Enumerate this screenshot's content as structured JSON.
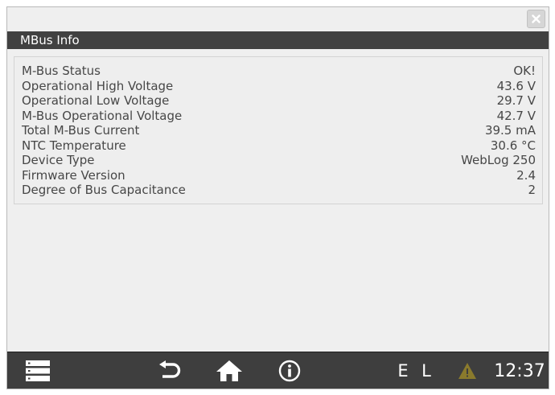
{
  "window": {
    "title": "MBus Info",
    "close_label": "×"
  },
  "info_rows": [
    {
      "label": "M-Bus Status",
      "value": "OK!"
    },
    {
      "label": "Operational High Voltage",
      "value": "43.6 V"
    },
    {
      "label": "Operational Low Voltage",
      "value": "29.7 V"
    },
    {
      "label": "M-Bus Operational Voltage",
      "value": "42.7 V"
    },
    {
      "label": "Total M-Bus Current",
      "value": "39.5 mA"
    },
    {
      "label": "NTC Temperature",
      "value": "30.6 °C"
    },
    {
      "label": "Device Type",
      "value": "WebLog 250"
    },
    {
      "label": "Firmware Version",
      "value": "2.4"
    },
    {
      "label": "Degree of Bus Capacitance",
      "value": "2"
    }
  ],
  "bottom_bar": {
    "menu_icon": "menu-list-icon",
    "back_icon": "back-arrow-icon",
    "home_icon": "home-icon",
    "info_icon": "info-icon",
    "indicator_e": "E",
    "indicator_l": "L",
    "warning_icon": "warning-icon",
    "time": "12:37"
  },
  "colors": {
    "title_bar": "#414141",
    "bottom_bar": "#3e3e3e",
    "warning_fill": "#8a7a2c",
    "panel_text": "#474747"
  }
}
